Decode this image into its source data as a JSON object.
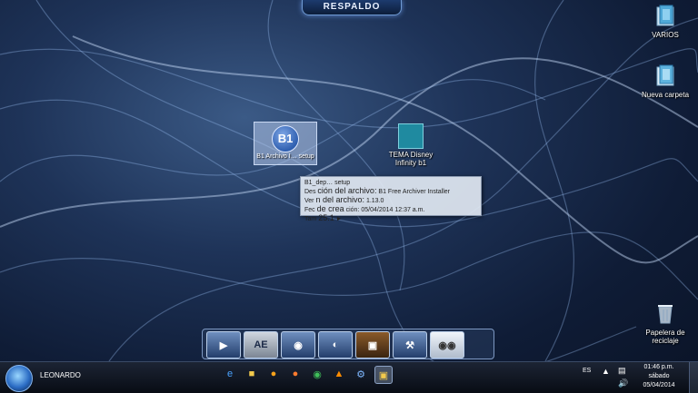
{
  "banner": {
    "label": "RESPALDO"
  },
  "desktop_icons": {
    "varios": "VARIOS",
    "nueva_carpeta": "Nueva carpeta",
    "papelera": "Papelera de reciclaje",
    "b1_letter": "B1",
    "b1_label": "B1 Archivo I… setup",
    "tema_label": "TEMA Disney Infinity b1"
  },
  "tooltip": {
    "line1": "B1_dep… setup",
    "line2_label": "Des",
    "line2_big": "ción del archivo:",
    "line2_value": "B1 Free Archiver Installer",
    "line3_label": "Ver",
    "line3_big": "n del archivo:",
    "line3_value": "1.13.0",
    "line4_label": "Fec",
    "line4_big": "de crea",
    "line4_mid": "ción:",
    "line4_value": "05/04/2014 12:37 a.m.",
    "line5_label": "Tam",
    "line5_value": "25.1"
  },
  "dock": {
    "ae_label": "AE"
  },
  "taskbar": {
    "user": "LEONARDO",
    "language": "ES",
    "time": "01:46 p.m.",
    "day": "sábado",
    "date": "05/04/2014"
  },
  "icons": {
    "start": "windows-orb-icon",
    "ie": "internet-explorer-icon",
    "explorer": "folder-icon",
    "firefox": "firefox-icon",
    "chrome": "chrome-icon",
    "vlc": "vlc-icon"
  }
}
